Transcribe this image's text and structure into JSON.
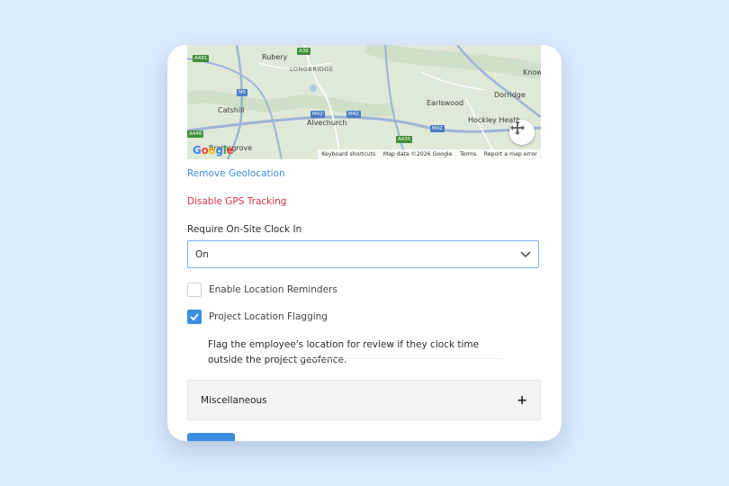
{
  "map": {
    "places": [
      "Rubery",
      "LONGBRIDGE",
      "Catshill",
      "Alvechurch",
      "Earlswood",
      "Dorridge",
      "Know",
      "Hockley Heath",
      "Bromsgrove"
    ],
    "road_shields": [
      "A38",
      "A491",
      "M5",
      "M42",
      "M42",
      "M42",
      "A435",
      "A448"
    ],
    "attribution": {
      "shortcuts": "Keyboard shortcuts",
      "data": "Map data ©2026 Google",
      "terms": "Terms",
      "report": "Report a map error"
    },
    "logo": "Google"
  },
  "actions": {
    "remove_geolocation": "Remove Geolocation",
    "disable_gps": "Disable GPS Tracking"
  },
  "clock_in": {
    "label": "Require On-Site Clock In",
    "value": "On"
  },
  "options": {
    "reminders": {
      "label": "Enable Location Reminders",
      "checked": false
    },
    "flagging": {
      "label": "Project Location Flagging",
      "checked": true
    },
    "flagging_description": "Flag the employee's location for review if they clock time outside the project geofence."
  },
  "accordion": {
    "title": "Miscellaneous",
    "toggle": "+"
  },
  "colors": {
    "accent": "#3b8de0",
    "danger": "#d3324a",
    "background": "#dcebfc"
  }
}
